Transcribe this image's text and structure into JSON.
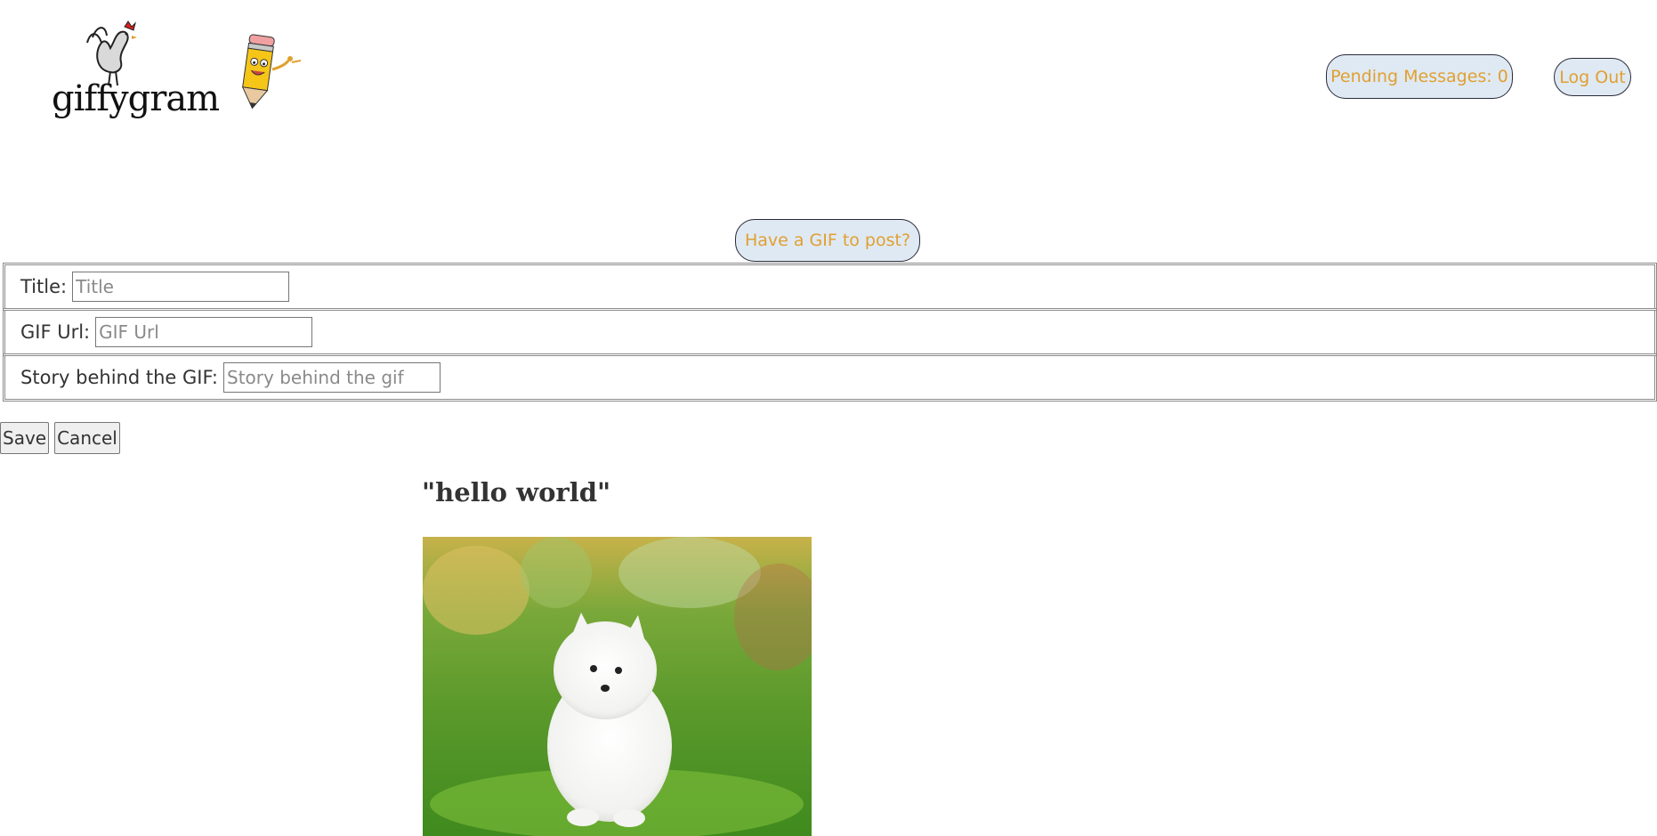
{
  "header": {
    "logo_text": "giffygram",
    "pending_messages": "Pending Messages: 0",
    "logout_label": "Log Out"
  },
  "post_prompt": "Have a GIF to post?",
  "form": {
    "title_label": "Title:",
    "title_placeholder": "Title",
    "url_label": "GIF Url:",
    "url_placeholder": "GIF Url",
    "story_label": "Story behind the GIF:",
    "story_placeholder": "Story behind the gif",
    "save_label": "Save",
    "cancel_label": "Cancel"
  },
  "post": {
    "title": "\"hello world\"",
    "image_alt": "white fluffy puppy sitting on grass"
  },
  "colors": {
    "accent_text": "#e0a030",
    "pill_bg": "#dfe9f3"
  }
}
